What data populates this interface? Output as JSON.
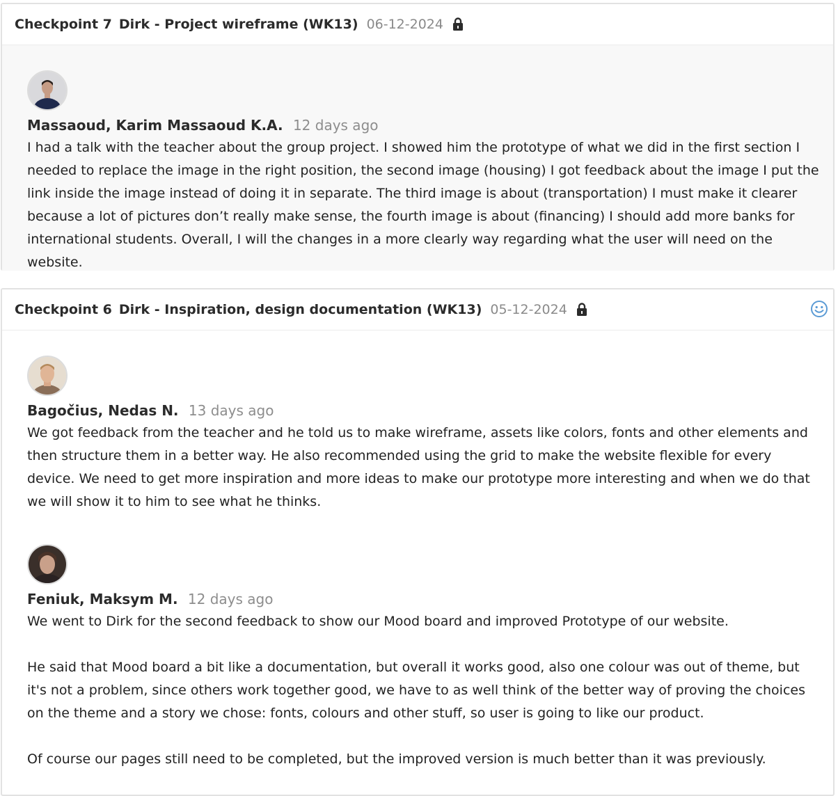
{
  "checkpoints": [
    {
      "label": "Checkpoint 7",
      "title": "Dirk - Project wireframe (WK13)",
      "date": "06-12-2024",
      "lock_icon": "lock-icon",
      "entries": [
        {
          "author": "Massaoud, Karim Massaoud K.A.",
          "time_ago": "12 days ago",
          "avatar_icon": "avatar-photo",
          "paragraphs": [
            "I had a talk with the teacher about the group project. I showed him the prototype of what we did in the first section I needed to replace the image in the right position, the second image (housing) I got feedback about the image I put the link inside the image instead of doing it in separate. The third image is about (transportation) I must make it clearer because a lot of pictures don’t really make sense, the fourth image is about (financing) I should add more banks for international students. Overall, I will the changes in a more clearly way regarding what the user will need on the website."
          ]
        }
      ]
    },
    {
      "label": "Checkpoint 6",
      "title": "Dirk - Inspiration, design documentation (WK13)",
      "date": "05-12-2024",
      "lock_icon": "lock-icon",
      "status_icon": "smiley-icon",
      "entries": [
        {
          "author": "Bagočius, Nedas N.",
          "time_ago": "13 days ago",
          "avatar_icon": "avatar-photo",
          "paragraphs": [
            "We got feedback from the teacher and he told us to make wireframe, assets like colors, fonts and other elements and then structure them in a better way. He also recommended using the grid to make the website flexible for every device. We need to get more inspiration and more ideas to make our prototype more interesting and when we do that we will show it to him to see what he thinks."
          ]
        },
        {
          "author": "Feniuk, Maksym M.",
          "time_ago": "12 days ago",
          "avatar_icon": "avatar-photo",
          "paragraphs": [
            "We went to Dirk for the second feedback to show our Mood board and improved Prototype of our website.",
            "He said that Mood board a bit like a documentation, but overall it works good, also one colour was out of theme, but it's not a problem, since others work together good, we have to as well think of the better way of proving the choices on the theme and a story we chose: fonts, colours and other stuff, so user is going to like our product.",
            "Of course our pages still need to be completed, but the improved version is much better than it was previously."
          ]
        }
      ]
    }
  ],
  "colors": {
    "date": "#8a8a8a",
    "ago": "#8d8d8d",
    "smiley": "#5b9bd5",
    "card_border": "#e2e2e2",
    "card_body_gray": "#f8f8f8"
  }
}
